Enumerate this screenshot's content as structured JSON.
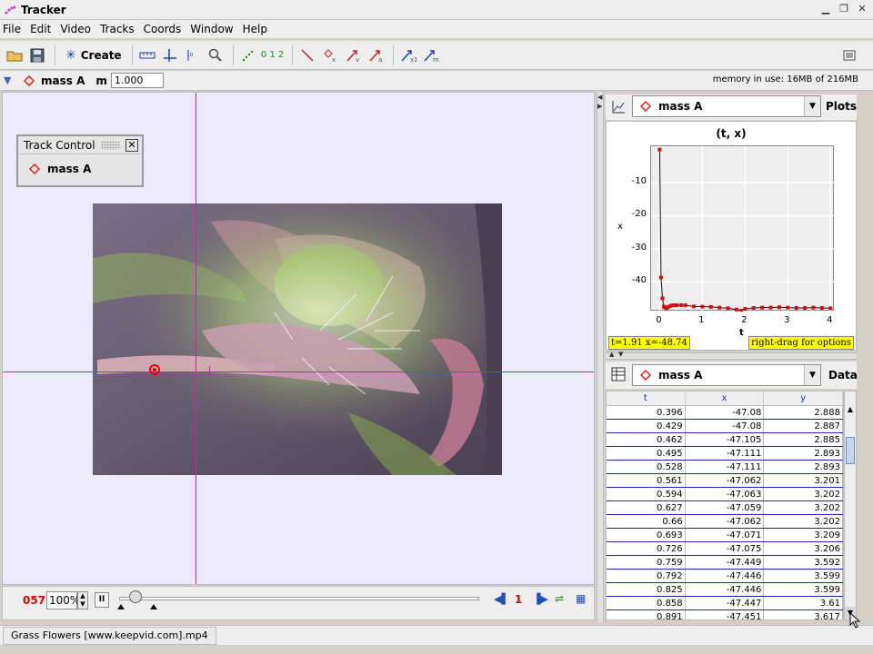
{
  "window": {
    "title": "Tracker"
  },
  "menu": [
    "File",
    "Edit",
    "Video",
    "Tracks",
    "Coords",
    "Window",
    "Help"
  ],
  "toolbar": {
    "create_label": "Create",
    "step_label": "0 1 2"
  },
  "trackbar": {
    "track_name": "mass A",
    "mass_label": "m",
    "mass_value": "1.000",
    "memory": "memory in use: 16MB of 216MB"
  },
  "track_control": {
    "title": "Track Control",
    "item": "mass A"
  },
  "player": {
    "frame": "057",
    "zoom": "100%",
    "step_size": "1"
  },
  "status": {
    "video_file": "Grass Flowers [www.keepvid.com].mp4"
  },
  "plot_panel": {
    "track": "mass A",
    "button": "Plots",
    "title": "(t, x)",
    "xlabel": "t",
    "ylabel": "x",
    "readout": "t=1.91  x=-48.74",
    "hint": "right-drag for options"
  },
  "chart_data": {
    "type": "line",
    "title": "(t, x)",
    "xlabel": "t",
    "ylabel": "x",
    "xlim": [
      -0.2,
      4.1
    ],
    "ylim": [
      -49,
      1
    ],
    "xticks": [
      0,
      1,
      2,
      3,
      4
    ],
    "yticks": [
      -10,
      -20,
      -30,
      -40
    ],
    "series": [
      {
        "x": [
          0,
          0.033,
          0.066,
          0.099,
          0.132,
          0.165,
          0.2,
          0.25,
          0.3,
          0.35,
          0.396,
          0.5,
          0.6,
          0.8,
          1.0,
          1.2,
          1.4,
          1.6,
          1.8,
          1.91,
          2.0,
          2.2,
          2.4,
          2.6,
          2.8,
          3.0,
          3.2,
          3.4,
          3.6,
          3.8,
          4.0
        ],
        "values": [
          0,
          -38.7,
          -45.0,
          -47.5,
          -47.8,
          -48.0,
          -47.6,
          -47.3,
          -47.1,
          -47.1,
          -47.08,
          -47.06,
          -47.1,
          -47.45,
          -47.5,
          -47.6,
          -47.8,
          -48.0,
          -48.4,
          -48.74,
          -48.2,
          -47.9,
          -47.8,
          -47.8,
          -47.7,
          -47.8,
          -47.9,
          -47.9,
          -47.8,
          -47.9,
          -48.0
        ]
      }
    ]
  },
  "data_panel": {
    "track": "mass A",
    "button": "Data",
    "columns": [
      "t",
      "x",
      "y"
    ],
    "rows": [
      [
        "0.396",
        "-47.08",
        "2.888"
      ],
      [
        "0.429",
        "-47.08",
        "2.887"
      ],
      [
        "0.462",
        "-47.105",
        "2.885"
      ],
      [
        "0.495",
        "-47.111",
        "2.893"
      ],
      [
        "0.528",
        "-47.111",
        "2.893"
      ],
      [
        "0.561",
        "-47.062",
        "3.201"
      ],
      [
        "0.594",
        "-47.063",
        "3.202"
      ],
      [
        "0.627",
        "-47.059",
        "3.202"
      ],
      [
        "0.66",
        "-47.062",
        "3.202"
      ],
      [
        "0.693",
        "-47.071",
        "3.209"
      ],
      [
        "0.726",
        "-47.075",
        "3.206"
      ],
      [
        "0.759",
        "-47.449",
        "3.592"
      ],
      [
        "0.792",
        "-47.446",
        "3.599"
      ],
      [
        "0.825",
        "-47.446",
        "3.599"
      ],
      [
        "0.858",
        "-47.447",
        "3.61"
      ],
      [
        "0.891",
        "-47.451",
        "3.617"
      ]
    ]
  },
  "colors": {
    "axis": "#c025b5",
    "marker": "#e00000",
    "highlight": "#ffff00",
    "background": "#eceafb"
  }
}
